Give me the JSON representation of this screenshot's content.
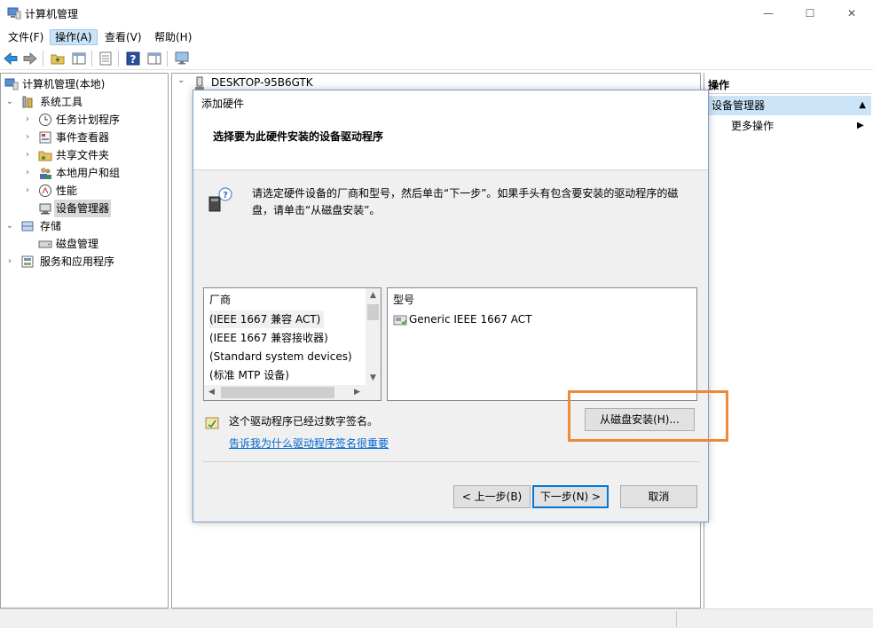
{
  "window": {
    "title": "计算机管理",
    "minimize_glyph": "—",
    "maximize_glyph": "☐",
    "close_glyph": "✕"
  },
  "menu": [
    {
      "label": "文件(F)"
    },
    {
      "label": "操作(A)"
    },
    {
      "label": "查看(V)"
    },
    {
      "label": "帮助(H)"
    }
  ],
  "tree": {
    "root": "计算机管理(本地)",
    "system_tools": "系统工具",
    "task_scheduler": "任务计划程序",
    "event_viewer": "事件查看器",
    "shared_folders": "共享文件夹",
    "local_users": "本地用户和组",
    "performance": "性能",
    "device_manager": "设备管理器",
    "storage": "存储",
    "disk_management": "磁盘管理",
    "services_apps": "服务和应用程序",
    "expanded_glyph": "⌄",
    "collapsed_glyph": "›"
  },
  "center": {
    "computer_name": "DESKTOP-95B6GTK"
  },
  "actions": {
    "header": "操作",
    "selected": "设备管理器",
    "more": "更多操作"
  },
  "dialog": {
    "title": "添加硬件",
    "heading": "选择要为此硬件安装的设备驱动程序",
    "instruction": "请选定硬件设备的厂商和型号，然后单击“下一步”。如果手头有包含要安装的驱动程序的磁盘，请单击“从磁盘安装”。",
    "manufacturer_header": "厂商",
    "manufacturers": [
      "(IEEE 1667 兼容 ACT)",
      "(IEEE 1667 兼容接收器)",
      "(Standard system devices)",
      "(标准 MTP 设备)"
    ],
    "model_header": "型号",
    "models": [
      "Generic IEEE 1667 ACT"
    ],
    "signed_text": "这个驱动程序已经过数字签名。",
    "signed_link": "告诉我为什么驱动程序签名很重要",
    "have_disk_button": "从磁盘安装(H)...",
    "back_button": "< 上一步(B)",
    "next_button": "下一步(N) >",
    "cancel_button": "取消"
  },
  "colors": {
    "accent": "#0078d7",
    "selection": "#cce4f7",
    "highlight_box": "#ee8a38",
    "link": "#0066cc"
  }
}
